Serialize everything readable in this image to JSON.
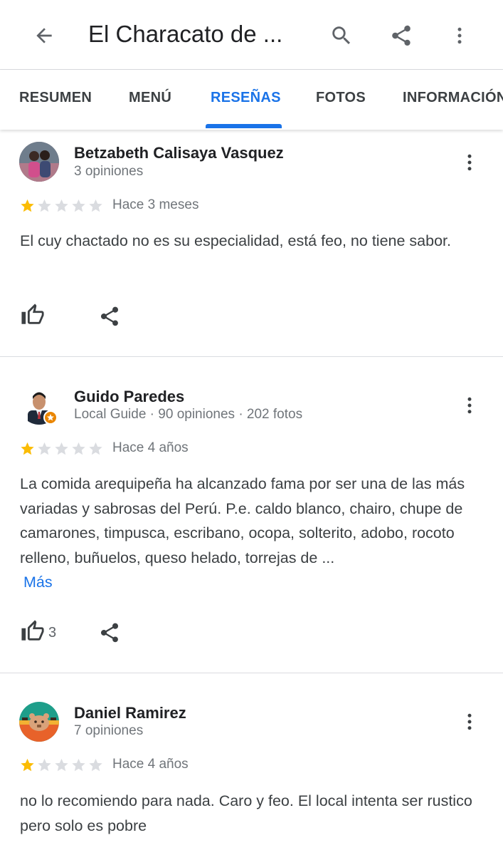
{
  "header": {
    "title": "El Characato de ...",
    "icons": [
      "back-arrow-icon",
      "search-icon",
      "share-icon",
      "more-vert-icon"
    ]
  },
  "tabs": [
    {
      "label": "RESUMEN",
      "active": false
    },
    {
      "label": "MENÚ",
      "active": false
    },
    {
      "label": "RESEÑAS",
      "active": true
    },
    {
      "label": "FOTOS",
      "active": false
    },
    {
      "label": "INFORMACIÓN",
      "active": false
    }
  ],
  "colors": {
    "accent": "#1a73e8",
    "star_filled": "#fbbc04",
    "star_empty": "#dadce0",
    "text_primary": "#202124",
    "text_secondary": "#70757a"
  },
  "reviews": [
    {
      "name": "Betzabeth Calisaya Vasquez",
      "meta": "3 opiniones",
      "rating": 1,
      "max_rating": 5,
      "date": "Hace 3 meses",
      "text": "El cuy chactado no es su especialidad, está feo, no tiene sabor.",
      "more_label": "",
      "likes": ""
    },
    {
      "name": "Guido Paredes",
      "meta": "Local Guide · 90 opiniones · 202 fotos",
      "rating": 1,
      "max_rating": 5,
      "date": "Hace 4 años",
      "text": "La comida arequipeña ha alcanzado fama por ser una de las más variadas y sabrosas del Perú. P.e. caldo blanco, chairo, chupe de camarones, timpusca, escribano, ocopa, solterito, adobo, rocoto relleno, buñuelos, queso helado, torrejas de ...",
      "more_label": "Más",
      "likes": "3"
    },
    {
      "name": "Daniel Ramirez",
      "meta": "7 opiniones",
      "rating": 1,
      "max_rating": 5,
      "date": "Hace 4 años",
      "text": "no lo recomiendo para nada. Caro y feo. El local intenta ser rustico pero solo es pobre",
      "more_label": "",
      "likes": ""
    }
  ]
}
